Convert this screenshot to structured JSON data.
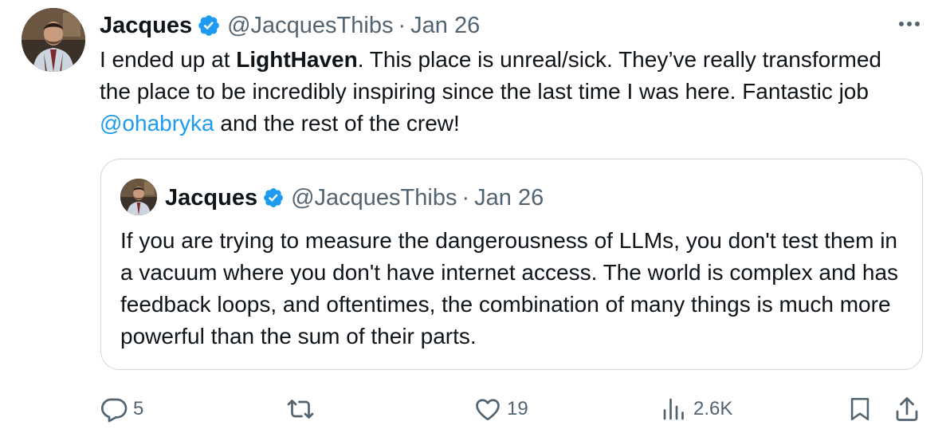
{
  "tweet": {
    "author_name": "Jacques",
    "handle": "@JacquesThibs",
    "separator": "·",
    "date": "Jan 26",
    "text_part1": "I ended up at ",
    "text_bold": "LightHaven",
    "text_part2": ". This place is unreal/sick. They’ve really transformed the place to be incredibly inspiring since the last time I was here. Fantastic job ",
    "mention": "@ohabryka",
    "text_part3": " and the rest of the crew!"
  },
  "quoted_tweet": {
    "author_name": "Jacques",
    "handle": "@JacquesThibs",
    "separator": "·",
    "date": "Jan 26",
    "text": "If you are trying to measure the dangerousness of LLMs, you don't test them in a vacuum where you don't have internet access. The world is complex and has feedback loops, and oftentimes, the combination of many things is much more powerful than the sum of their parts."
  },
  "actions": {
    "replies": "5",
    "retweets": "",
    "likes": "19",
    "views": "2.6K"
  },
  "colors": {
    "text": "#0f1419",
    "secondary": "#536471",
    "accent": "#1d9bf0",
    "border": "#cfd9de"
  },
  "icons": [
    "more-icon",
    "verified-badge-icon",
    "reply-icon",
    "retweet-icon",
    "like-icon",
    "views-icon",
    "bookmark-icon",
    "share-icon"
  ]
}
